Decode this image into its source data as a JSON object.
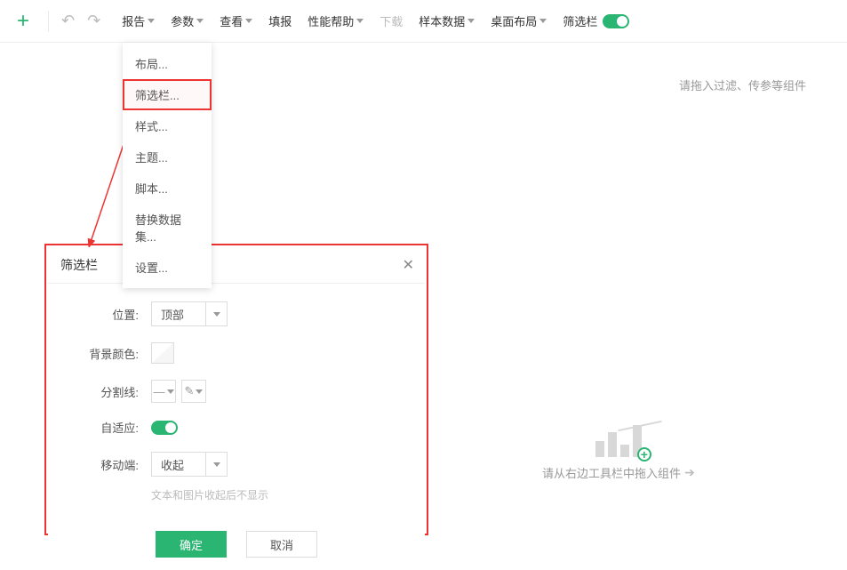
{
  "toolbar": {
    "menus": {
      "report": "报告",
      "param": "参数",
      "view": "查看",
      "fillReport": "填报",
      "perf": "性能帮助",
      "download": "下载",
      "sample": "样本数据",
      "desktopLayout": "桌面布局",
      "filterBar": "筛选栏"
    }
  },
  "dropdown": {
    "items": {
      "layout": "布局...",
      "filterBar": "筛选栏...",
      "style": "样式...",
      "theme": "主题...",
      "script": "脚本...",
      "replaceDs": "替换数据集...",
      "settings": "设置..."
    }
  },
  "dropHint": "请拖入过滤、传参等组件",
  "chartHint": "请从右边工具栏中拖入组件",
  "dialog": {
    "title": "筛选栏",
    "labels": {
      "position": "位置:",
      "bgColor": "背景颜色:",
      "divider": "分割线:",
      "adaptive": "自适应:",
      "mobile": "移动端:"
    },
    "values": {
      "position": "顶部",
      "mobile": "收起"
    },
    "hint": "文本和图片收起后不显示",
    "buttons": {
      "ok": "确定",
      "cancel": "取消"
    }
  }
}
